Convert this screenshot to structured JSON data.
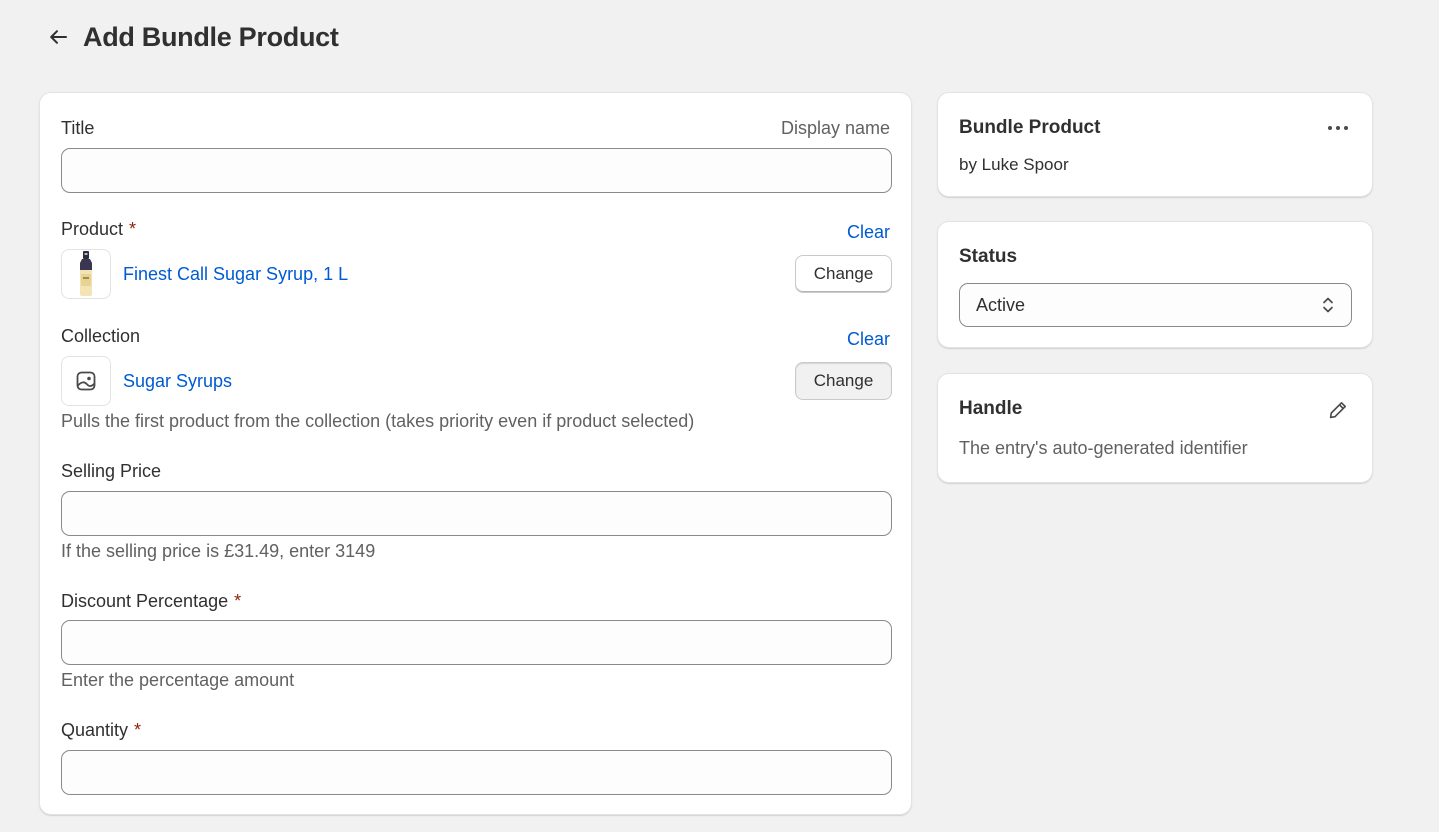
{
  "header": {
    "title": "Add Bundle Product"
  },
  "form": {
    "title_field": {
      "label": "Title",
      "hint_right": "Display name",
      "value": ""
    },
    "product": {
      "label": "Product",
      "required_mark": "*",
      "clear_label": "Clear",
      "selected_name": "Finest Call Sugar Syrup, 1 L",
      "change_label": "Change"
    },
    "collection": {
      "label": "Collection",
      "clear_label": "Clear",
      "selected_name": "Sugar Syrups",
      "change_label": "Change",
      "help_text": "Pulls the first product from the collection (takes priority even if product selected)"
    },
    "selling_price": {
      "label": "Selling Price",
      "value": "",
      "help_text": "If the selling price is £31.49, enter 3149"
    },
    "discount": {
      "label": "Discount Percentage",
      "required_mark": "*",
      "value": "",
      "help_text": "Enter the percentage amount"
    },
    "quantity": {
      "label": "Quantity",
      "required_mark": "*",
      "value": ""
    }
  },
  "sidebar": {
    "bundle": {
      "title": "Bundle Product",
      "author": "by Luke Spoor",
      "menu_icon": "ellipsis-icon"
    },
    "status": {
      "title": "Status",
      "value": "Active",
      "icon": "select-chevrons-icon"
    },
    "handle": {
      "title": "Handle",
      "description": "The entry's auto-generated identifier",
      "edit_icon": "pencil-icon"
    }
  },
  "colors": {
    "background": "#f1f1f1",
    "card": "#ffffff",
    "link": "#005bd3",
    "required": "#8e1f0b",
    "text": "#303030",
    "muted": "#616161"
  }
}
